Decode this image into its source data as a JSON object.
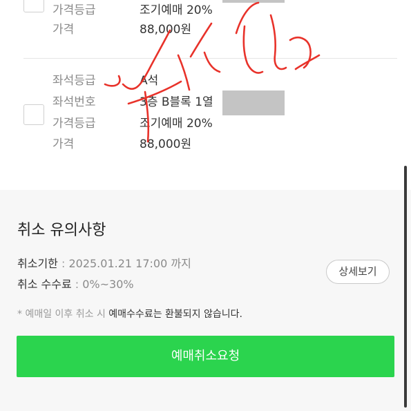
{
  "tickets": [
    {
      "rows": [
        {
          "label": "가격등급",
          "value": "조기예매 20%"
        },
        {
          "label": "가격",
          "value": "88,000원"
        }
      ]
    },
    {
      "rows": [
        {
          "label": "좌석등급",
          "value": "A석"
        },
        {
          "label": "좌석번호",
          "value": "3층 B블록 1열"
        },
        {
          "label": "가격등급",
          "value": "조기예매 20%"
        },
        {
          "label": "가격",
          "value": "88,000원"
        }
      ]
    }
  ],
  "cancel_notice": {
    "title": "취소 유의사항",
    "deadline_label": "취소기한",
    "deadline_value": "2025.01.21 17:00 까지",
    "fee_label": "취소 수수료",
    "fee_value": "0%~30%",
    "detail_button": "상세보기",
    "notice_prefix": "* 예매일 이후 취소 시 ",
    "notice_highlight": "예매수수료는 환불되지 않습니다.",
    "separator": " : "
  },
  "request_button": "예매취소요청",
  "colors": {
    "accent_green": "#2bd44e",
    "scribble_red": "#e8322a",
    "redaction_gray": "#c4c4c4"
  }
}
